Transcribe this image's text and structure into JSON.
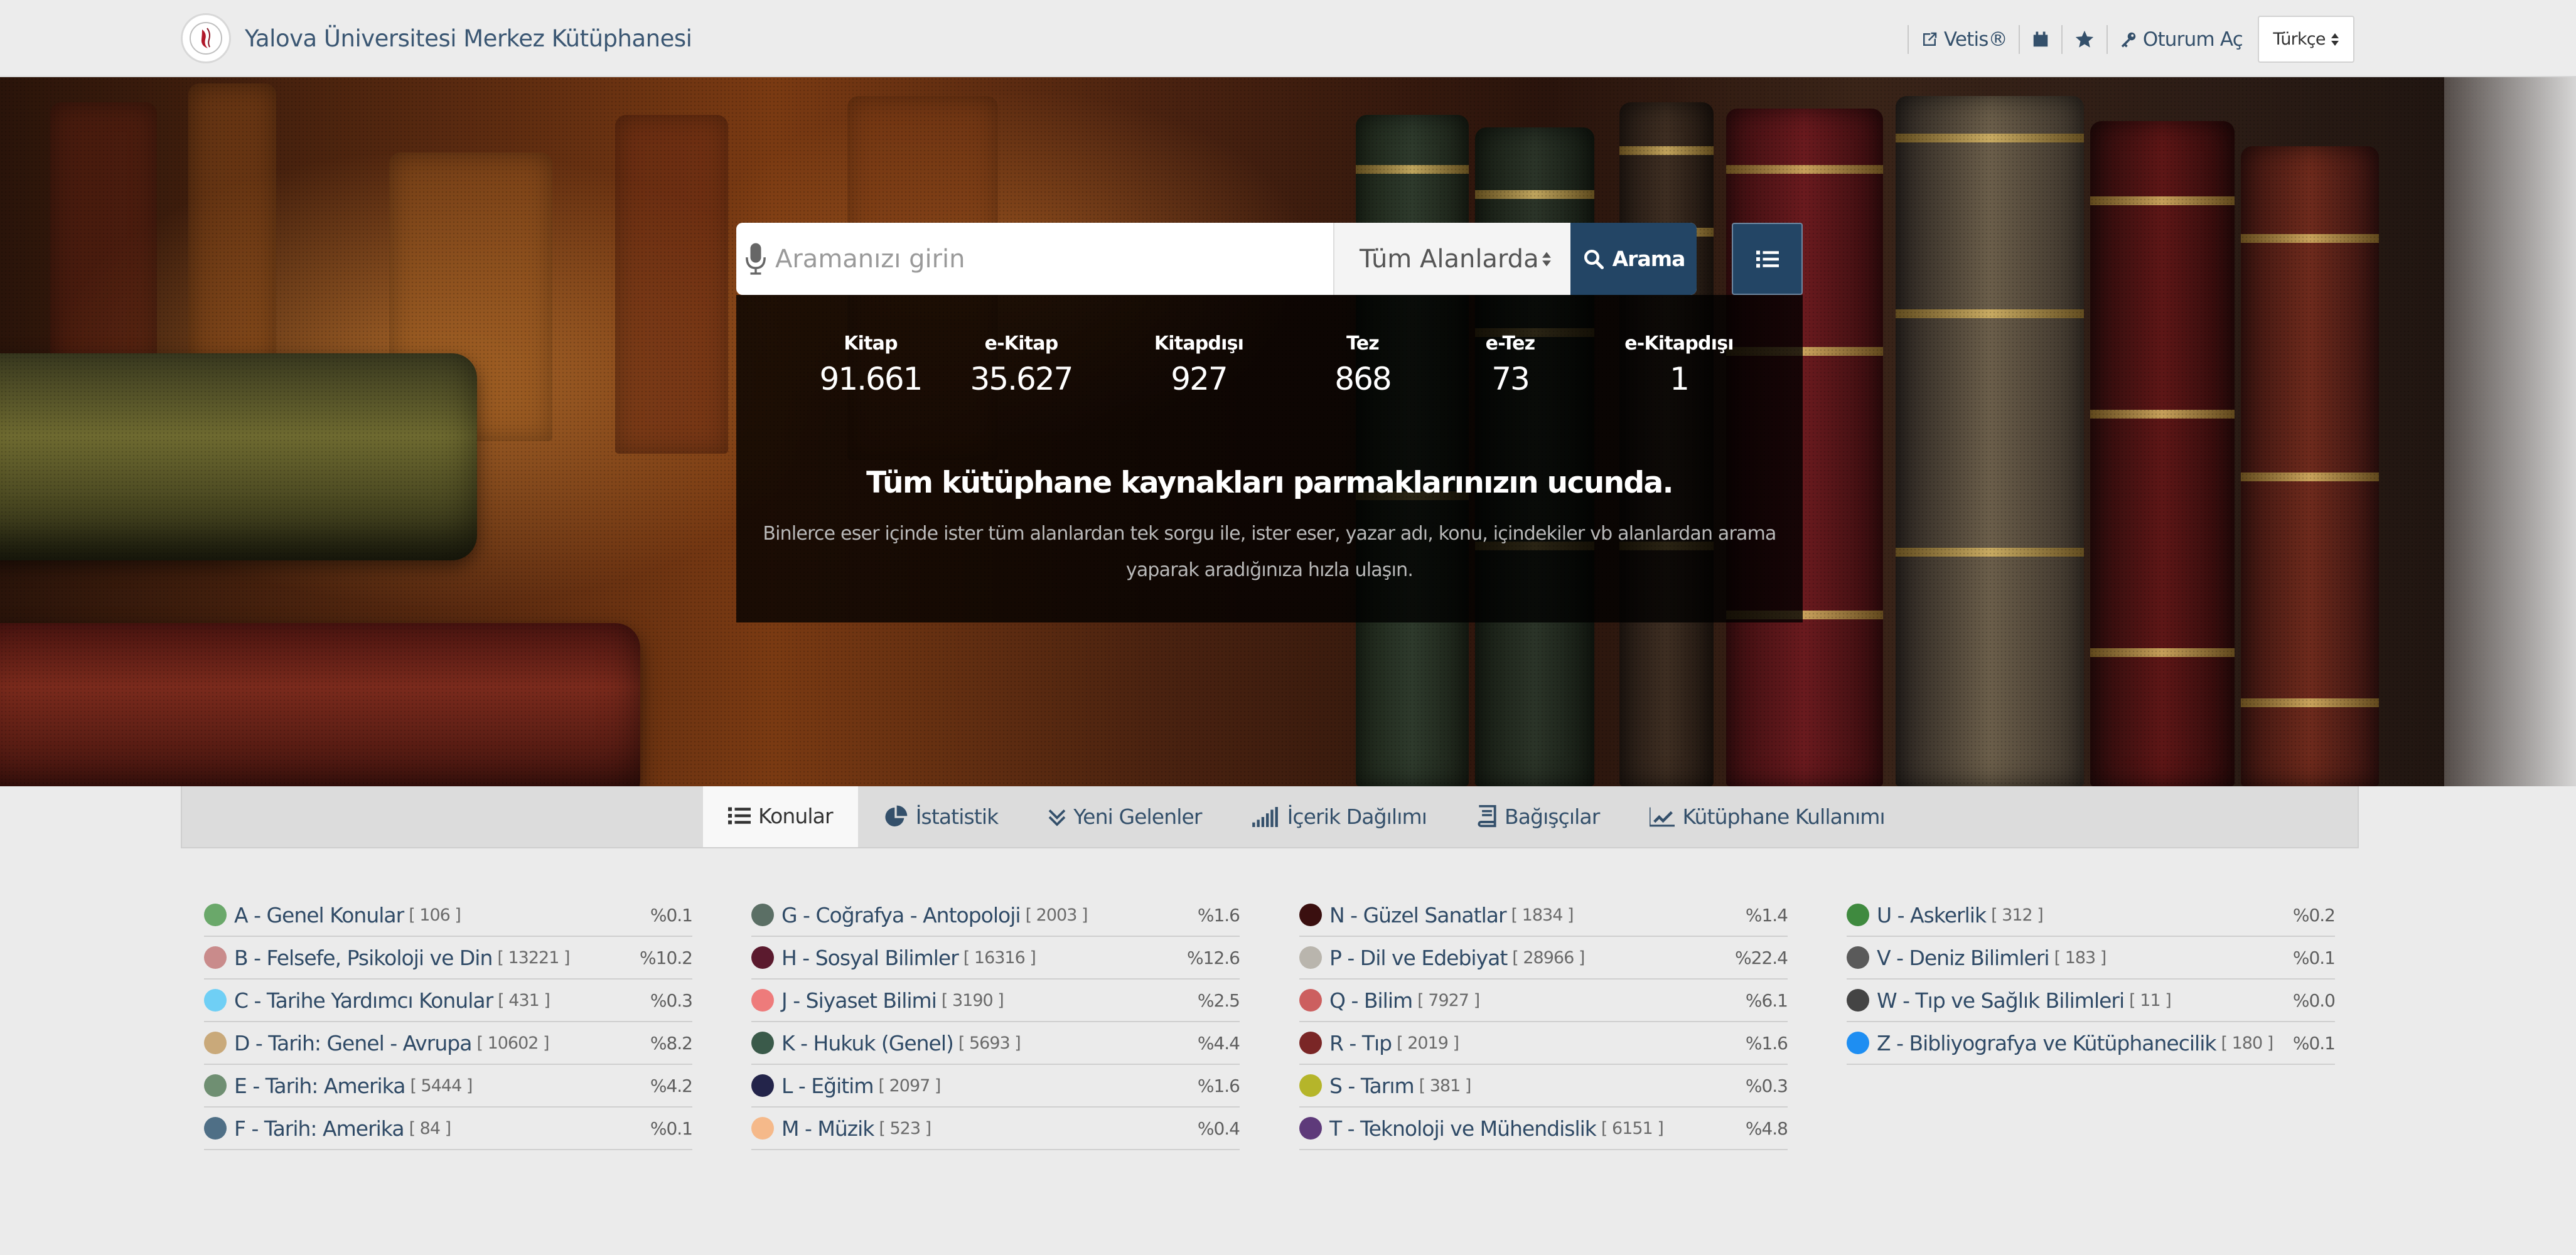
{
  "navbar": {
    "title": "Yalova Üniversitesi Merkez Kütüphanesi",
    "links": [
      {
        "label": "Vetis®",
        "icon": "external-link-icon"
      },
      {
        "label": "",
        "icon": "calendar-icon"
      },
      {
        "label": "",
        "icon": "star-icon"
      },
      {
        "label": "Oturum Aç",
        "icon": "key-icon"
      }
    ],
    "language": "Türkçe"
  },
  "search": {
    "placeholder": "Aramanızı girin",
    "field": "Tüm Alanlarda",
    "button": "Arama"
  },
  "stats": [
    {
      "label": "Kitap",
      "value": "91.661"
    },
    {
      "label": "e-Kitap",
      "value": "35.627"
    },
    {
      "label": "Kitapdışı",
      "value": "927"
    },
    {
      "label": "Tez",
      "value": "868"
    },
    {
      "label": "e-Tez",
      "value": "73"
    },
    {
      "label": "e-Kitapdışı",
      "value": "1"
    }
  ],
  "hero": {
    "headline": "Tüm kütüphane kaynakları parmaklarınızın ucunda.",
    "line1": "Binlerce eser içinde ister tüm alanlardan tek sorgu ile, ister eser, yazar adı, konu, içindekiler vb alanlardan arama",
    "line2": "yaparak aradığınıza hızla ulaşın."
  },
  "tabs": [
    {
      "label": "Konular",
      "icon": "list-icon"
    },
    {
      "label": "İstatistik",
      "icon": "pie-chart-icon"
    },
    {
      "label": "Yeni Gelenler",
      "icon": "double-chevron-down-icon"
    },
    {
      "label": "İçerik Dağılımı",
      "icon": "signal-bars-icon"
    },
    {
      "label": "Bağışçılar",
      "icon": "book-icon"
    },
    {
      "label": "Kütüphane Kullanımı",
      "icon": "line-chart-icon"
    }
  ],
  "subjects": {
    "col1": [
      {
        "name": "A - Genel Konular",
        "count": "[ 106 ]",
        "pct": "%0.1",
        "color": "#6aa86a"
      },
      {
        "name": "B - Felsefe, Psikoloji ve Din",
        "count": "[ 13221 ]",
        "pct": "%10.2",
        "color": "#c98b8b"
      },
      {
        "name": "C - Tarihe Yardımcı Konular",
        "count": "[ 431 ]",
        "pct": "%0.3",
        "color": "#6fcff5"
      },
      {
        "name": "D - Tarih: Genel - Avrupa",
        "count": "[ 10602 ]",
        "pct": "%8.2",
        "color": "#c9a97a"
      },
      {
        "name": "E - Tarih: Amerika",
        "count": "[ 5444 ]",
        "pct": "%4.2",
        "color": "#6f8f72"
      },
      {
        "name": "F - Tarih: Amerika",
        "count": "[ 84 ]",
        "pct": "%0.1",
        "color": "#4f6f86"
      }
    ],
    "col2": [
      {
        "name": "G - Coğrafya - Antopoloji",
        "count": "[ 2003 ]",
        "pct": "%1.6",
        "color": "#5b6f65"
      },
      {
        "name": "H - Sosyal Bilimler",
        "count": "[ 16316 ]",
        "pct": "%12.6",
        "color": "#5b1a2e"
      },
      {
        "name": "J - Siyaset Bilimi",
        "count": "[ 3190 ]",
        "pct": "%2.5",
        "color": "#ee7b7b"
      },
      {
        "name": "K - Hukuk (Genel)",
        "count": "[ 5693 ]",
        "pct": "%4.4",
        "color": "#3a5a4a"
      },
      {
        "name": "L - Eğitim",
        "count": "[ 2097 ]",
        "pct": "%1.6",
        "color": "#23244a"
      },
      {
        "name": "M - Müzik",
        "count": "[ 523 ]",
        "pct": "%0.4",
        "color": "#f5b98a"
      }
    ],
    "col3": [
      {
        "name": "N - Güzel Sanatlar",
        "count": "[ 1834 ]",
        "pct": "%1.4",
        "color": "#3a0f0f"
      },
      {
        "name": "P - Dil ve Edebiyat",
        "count": "[ 28966 ]",
        "pct": "%22.4",
        "color": "#b9b5ad"
      },
      {
        "name": "Q - Bilim",
        "count": "[ 7927 ]",
        "pct": "%6.1",
        "color": "#cc5f5f"
      },
      {
        "name": "R - Tıp",
        "count": "[ 2019 ]",
        "pct": "%1.6",
        "color": "#7a2626"
      },
      {
        "name": "S - Tarım",
        "count": "[ 381 ]",
        "pct": "%0.3",
        "color": "#b5b52a"
      },
      {
        "name": "T - Teknoloji ve Mühendislik",
        "count": "[ 6151 ]",
        "pct": "%4.8",
        "color": "#5e3a7a"
      }
    ],
    "col4": [
      {
        "name": "U - Askerlik",
        "count": "[ 312 ]",
        "pct": "%0.2",
        "color": "#3f8a3f"
      },
      {
        "name": "V - Deniz Bilimleri",
        "count": "[ 183 ]",
        "pct": "%0.1",
        "color": "#5a5a5a"
      },
      {
        "name": "W - Tıp ve Sağlık Bilimleri",
        "count": "[ 11 ]",
        "pct": "%0.0",
        "color": "#444444"
      },
      {
        "name": "Z - Bibliyografya ve Kütüphanecilik",
        "count": "[ 180 ]",
        "pct": "%0.1",
        "color": "#1e8ef2"
      }
    ]
  }
}
